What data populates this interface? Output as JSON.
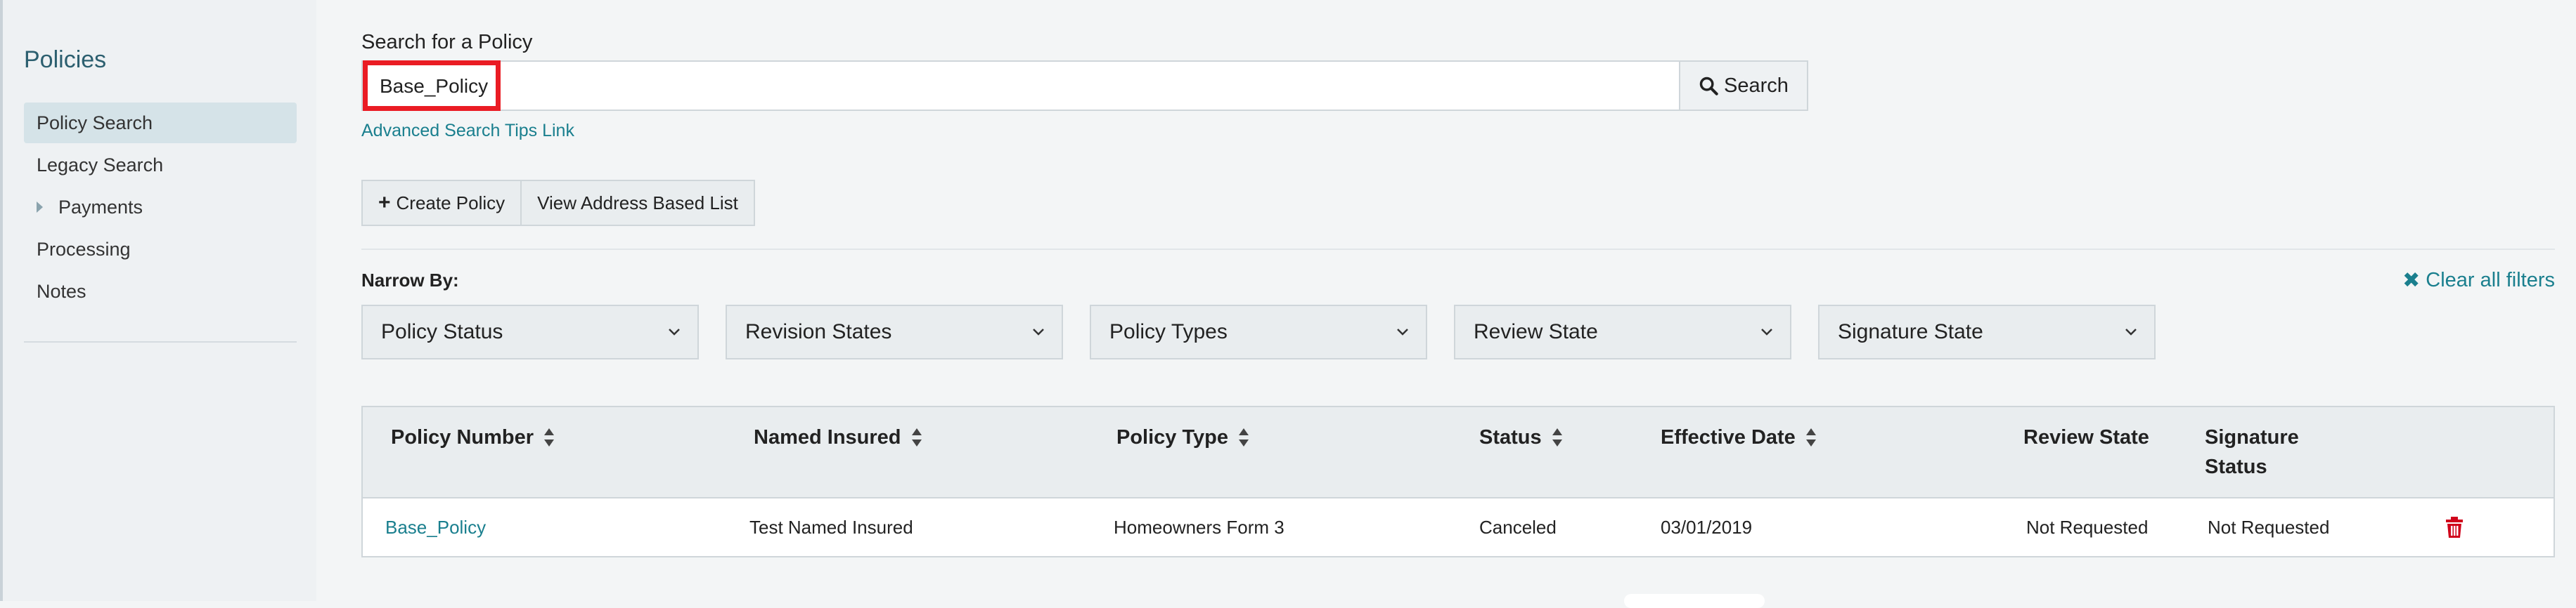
{
  "sidebar": {
    "title": "Policies",
    "items": [
      {
        "label": "Policy Search",
        "active": true
      },
      {
        "label": "Legacy Search",
        "active": false
      },
      {
        "label": "Payments",
        "active": false,
        "expandable": true
      },
      {
        "label": "Processing",
        "active": false
      },
      {
        "label": "Notes",
        "active": false
      }
    ]
  },
  "search": {
    "label": "Search for a Policy",
    "value": "Base_Policy",
    "button_label": "Search",
    "advanced_link": "Advanced Search Tips Link"
  },
  "actions": {
    "create_policy": "Create Policy",
    "view_address_list": "View Address Based List"
  },
  "filters": {
    "narrow_by_label": "Narrow By:",
    "clear_all": "Clear all filters",
    "items": [
      "Policy Status",
      "Revision States",
      "Policy Types",
      "Review State",
      "Signature State"
    ]
  },
  "table": {
    "columns": [
      {
        "label": "Policy Number",
        "sortable": true
      },
      {
        "label": "Named Insured",
        "sortable": true
      },
      {
        "label": "Policy Type",
        "sortable": true
      },
      {
        "label": "Status",
        "sortable": true
      },
      {
        "label": "Effective Date",
        "sortable": true
      },
      {
        "label": "Review State",
        "sortable": false
      },
      {
        "label": "Signature Status",
        "sortable": false
      }
    ],
    "rows": [
      {
        "policy_number": "Base_Policy",
        "named_insured": "Test Named Insured",
        "policy_type": "Homeowners Form 3",
        "status": "Canceled",
        "effective_date": "03/01/2019",
        "review_state": "Not Requested",
        "signature_status": "Not Requested"
      }
    ]
  },
  "colors": {
    "accent": "#1a7f8e",
    "highlight": "#ea1c24",
    "delete": "#d0021b"
  },
  "icons": {
    "search": "search-icon",
    "plus": "plus-icon",
    "clear": "close-icon",
    "chevron": "chevron-down-icon",
    "sort": "sort-icon",
    "delete": "trash-icon",
    "expand": "caret-right-icon"
  }
}
